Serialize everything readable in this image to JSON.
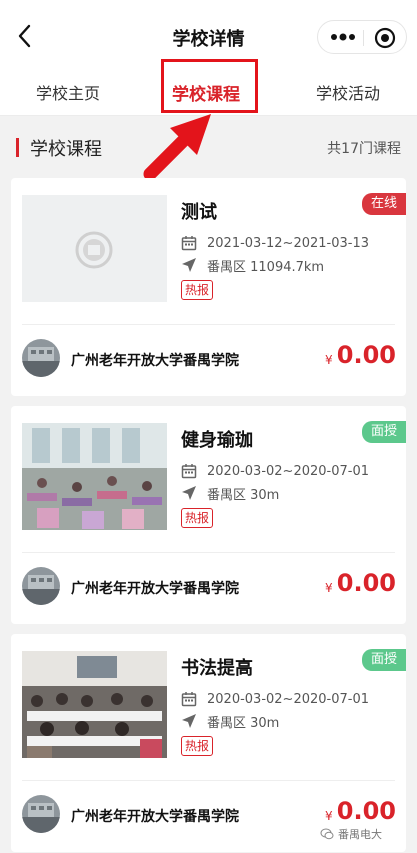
{
  "header": {
    "title": "学校详情",
    "back_icon": "chevron-left-icon",
    "more_icon": "ellipsis-icon",
    "close_icon": "target-close-icon"
  },
  "tabs": [
    {
      "label": "学校主页",
      "active": false
    },
    {
      "label": "学校课程",
      "active": true
    },
    {
      "label": "学校活动",
      "active": false
    }
  ],
  "section": {
    "title": "学校课程",
    "count_text": "共17门课程"
  },
  "courses": [
    {
      "title": "测试",
      "badge": "在线",
      "date_range": "2021-03-12~2021-03-13",
      "location": "番禺区 11094.7km",
      "tag": "热报",
      "school": "广州老年开放大学番禺学院",
      "currency": "¥",
      "price": "0.00"
    },
    {
      "title": "健身瑜珈",
      "badge": "面授",
      "date_range": "2020-03-02~2020-07-01",
      "location": "番禺区 30m",
      "tag": "热报",
      "school": "广州老年开放大学番禺学院",
      "currency": "¥",
      "price": "0.00"
    },
    {
      "title": "书法提高",
      "badge": "面授",
      "date_range": "2020-03-02~2020-07-01",
      "location": "番禺区 30m",
      "tag": "热报",
      "school": "广州老年开放大学番禺学院",
      "currency": "¥",
      "price": "0.00"
    }
  ],
  "watermark": {
    "text": "番禺电大"
  },
  "colors": {
    "accent": "#d9232a",
    "online_badge": "#d9363e",
    "offline_badge": "#5cc88c",
    "annotation": "#e3141b"
  }
}
